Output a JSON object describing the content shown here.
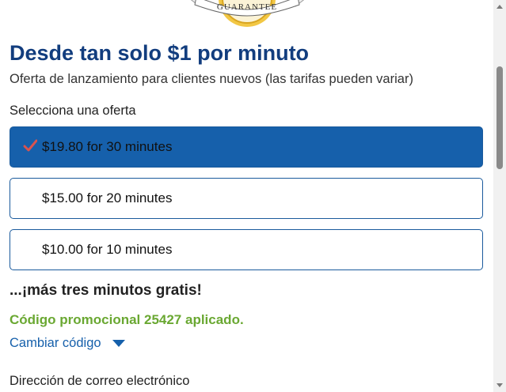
{
  "badge": {
    "text": "GUARANTEE"
  },
  "headline": "Desde tan solo $1 por minuto",
  "subheadline": "Oferta de lanzamiento para clientes nuevos (las tarifas pueden variar)",
  "offers": {
    "label": "Selecciona una oferta",
    "items": [
      {
        "label": "$19.80 for 30 minutes",
        "selected": true
      },
      {
        "label": "$15.00 for 20 minutes",
        "selected": false
      },
      {
        "label": "$10.00 for 10 minutes",
        "selected": false
      }
    ]
  },
  "bonus": "...¡más tres minutos gratis!",
  "promo": {
    "applied_text": "Código promocional 25427 aplicado.",
    "change_label": "Cambiar código"
  },
  "email": {
    "label": "Dirección de correo electrónico"
  },
  "icons": {
    "check": "check-icon",
    "caret": "chevron-down-icon"
  },
  "colors": {
    "headline": "#123d7e",
    "selected_offer": "#1660ab",
    "check": "#d9534f",
    "promo": "#6aa832",
    "link": "#1660ab"
  }
}
